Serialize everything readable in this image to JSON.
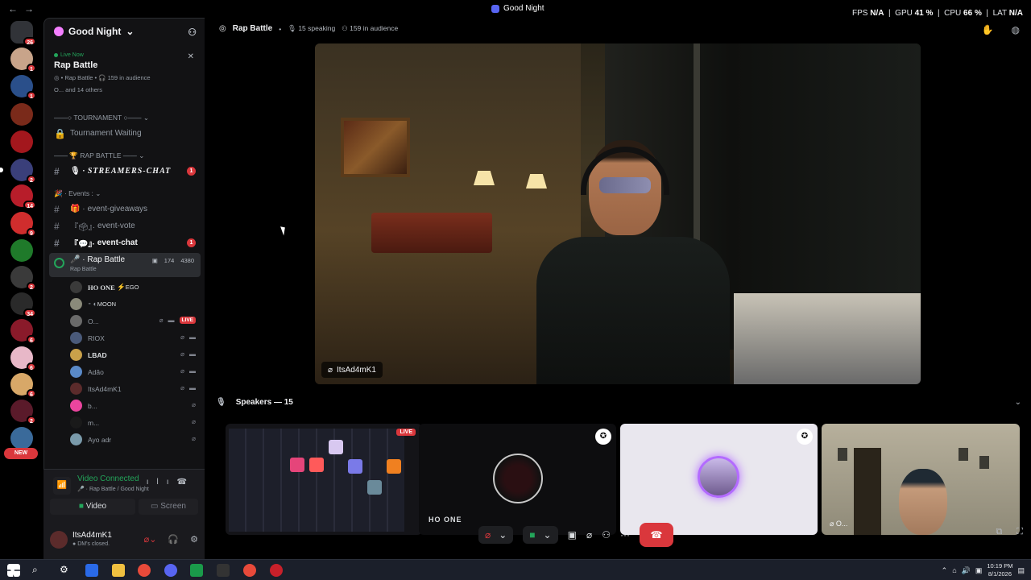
{
  "titlebar": {
    "title": "Good Night",
    "fps_label": "FPS",
    "fps_value": "N/A",
    "gpu_label": "GPU",
    "gpu_value": "41 %",
    "cpu_label": "CPU",
    "cpu_value": "66 %",
    "lat_label": "LAT",
    "lat_value": "N/A"
  },
  "servers": [
    {
      "badge": "26"
    },
    {
      "badge": "1"
    },
    {
      "badge": "1"
    },
    {
      "badge": ""
    },
    {
      "badge": ""
    },
    {
      "badge": "2"
    },
    {
      "badge": "14"
    },
    {
      "badge": "9"
    },
    {
      "badge": ""
    },
    {
      "badge": "2"
    },
    {
      "badge": "34"
    },
    {
      "badge": "6"
    },
    {
      "badge": "6"
    },
    {
      "badge": "6"
    },
    {
      "badge": "2"
    },
    {
      "badge": ""
    }
  ],
  "new_pill": "NEW",
  "sidebar": {
    "server_name": "Good Night",
    "live": {
      "status": "Live Now",
      "title": "Rap Battle",
      "sub_channel": "Rap Battle",
      "sub_audience": "159 in audience",
      "others": "O... and 14 others"
    },
    "categories": {
      "tournament": "TOURNAMENT",
      "rap_battle": "RAP BATTLE",
      "events": "Events :"
    },
    "channels": {
      "tournament_waiting": "Tournament Waiting",
      "streamers_chat": "STREAMERS-CHAT",
      "streamers_badge": "1",
      "giveaways": "event-giveaways",
      "vote": "event-vote",
      "chat": "event-chat",
      "chat_badge": "1"
    },
    "voice": {
      "name": "Rap Battle",
      "sub": "Rap Battle",
      "count1": "174",
      "count2": "4380"
    },
    "members": [
      {
        "name": "HO ONE",
        "extra": "EGO"
      },
      {
        "name": "MOON",
        "extra": ""
      },
      {
        "name": "O...",
        "extra": "LIVE"
      },
      {
        "name": "RIOX",
        "extra": ""
      },
      {
        "name": "LBAD",
        "extra": ""
      },
      {
        "name": "Adão",
        "extra": ""
      },
      {
        "name": "ItsAd4mK1",
        "extra": ""
      },
      {
        "name": "b...",
        "extra": ""
      },
      {
        "name": "m...",
        "extra": ""
      },
      {
        "name": "Ayo adr",
        "extra": ""
      }
    ]
  },
  "voice_panel": {
    "status": "Video Connected",
    "location": "Rap Battle / Good Night",
    "video_label": "Video",
    "screen_label": "Screen"
  },
  "user": {
    "name": "ItsAd4mK1",
    "status": "DM's closed."
  },
  "main": {
    "channel": "Rap Battle",
    "speaking": "15 speaking",
    "audience": "159 in audience",
    "stage_name": "ItsAd4mK1",
    "speakers_label": "Speakers — 15",
    "tile2_name": "HO ONE",
    "tile1_badge": "LIVE",
    "tile4_name": "O...",
    "icon_badge": "1"
  },
  "taskbar": {
    "time": "10:19 PM",
    "date": "8/1/2026"
  },
  "colors": {
    "accent_green": "#23a55a",
    "danger": "#da373c",
    "blurple": "#5865f2"
  }
}
